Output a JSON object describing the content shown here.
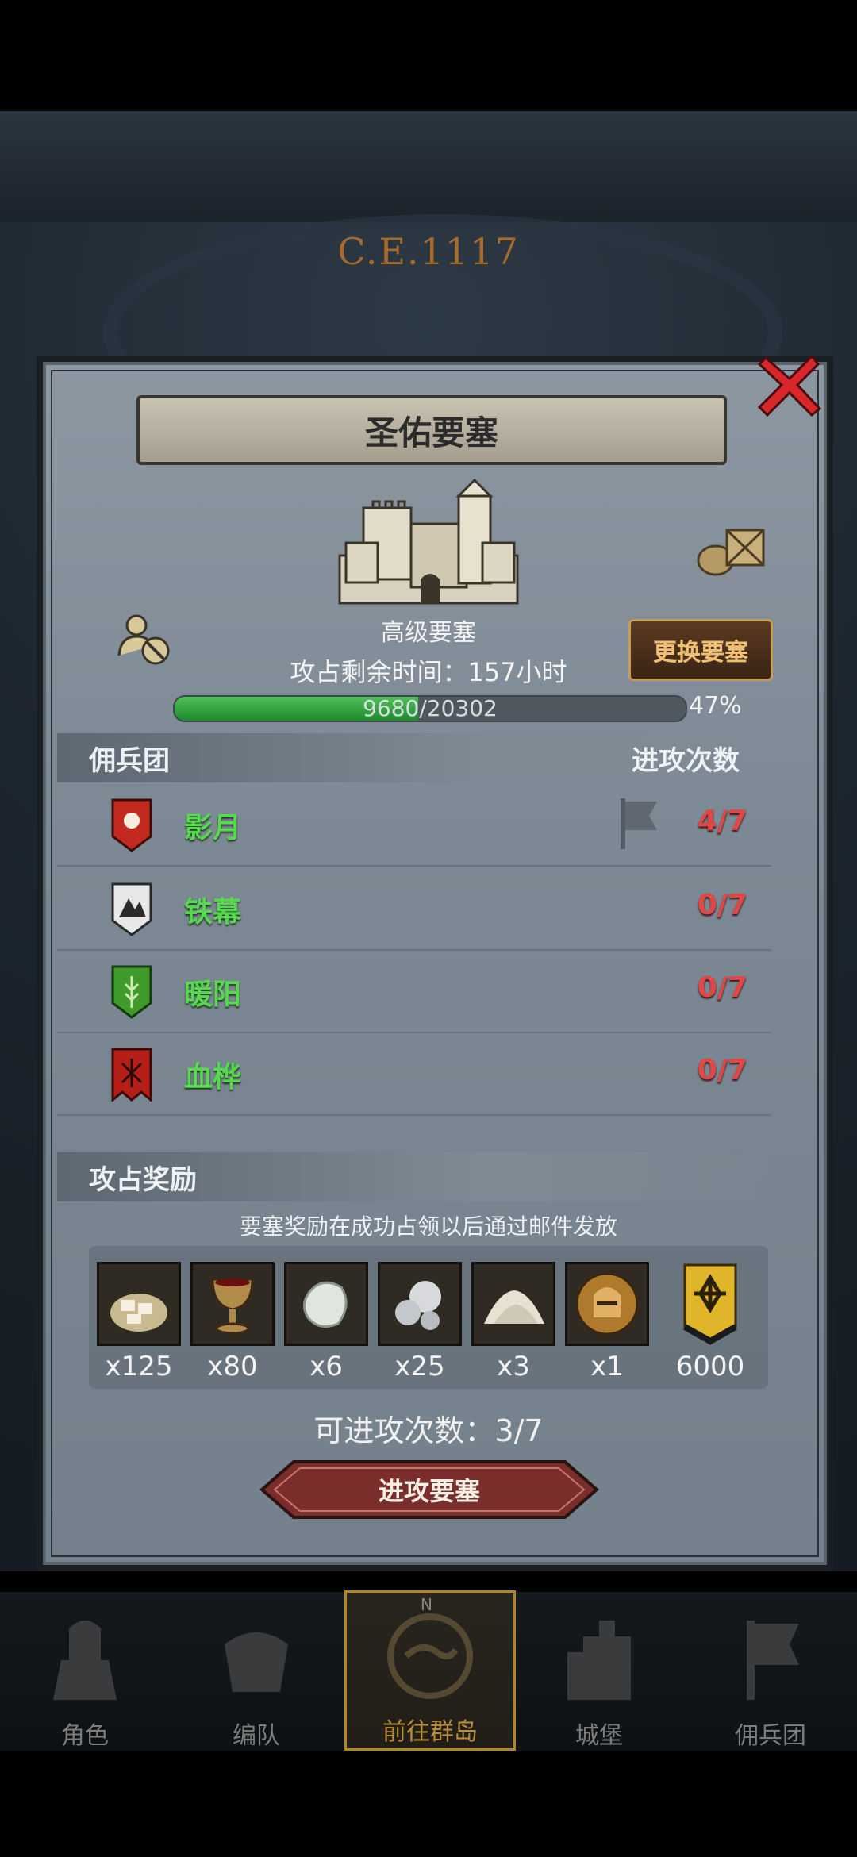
{
  "background": {
    "era_label": "C.E.1117"
  },
  "panel": {
    "title": "圣佑要塞",
    "fortress_type": "高级要塞",
    "time_left_label": "攻占剩余时间：157小时",
    "swap_button": "更换要塞",
    "progress": {
      "current": 9680,
      "total": 20302,
      "text": "9680/20302",
      "percent_label": "47%",
      "fraction": 0.477
    }
  },
  "mercenaries": {
    "header_left": "佣兵团",
    "header_right": "进攻次数",
    "rows": [
      {
        "name": "影月",
        "count": "4/7",
        "crest_color": "#c22a20",
        "has_flag": true
      },
      {
        "name": "铁幕",
        "count": "0/7",
        "crest_color": "#e8e8e8",
        "has_flag": false
      },
      {
        "name": "暖阳",
        "count": "0/7",
        "crest_color": "#3f9a2a",
        "has_flag": false
      },
      {
        "name": "血桦",
        "count": "0/7",
        "crest_color": "#b51f17",
        "has_flag": false
      }
    ]
  },
  "rewards": {
    "header": "攻占奖励",
    "note": "要塞奖励在成功占领以后通过邮件发放",
    "items": [
      {
        "icon": "bread-sack-icon",
        "qty": "x125"
      },
      {
        "icon": "goblet-icon",
        "qty": "x80"
      },
      {
        "icon": "pearl-stone-icon",
        "qty": "x6"
      },
      {
        "icon": "silver-orbs-icon",
        "qty": "x25"
      },
      {
        "icon": "salt-pile-icon",
        "qty": "x3"
      },
      {
        "icon": "knight-helmet-icon",
        "qty": "x1"
      },
      {
        "icon": "gold-emblem-icon",
        "qty": "6000"
      }
    ]
  },
  "attacks_available": "可进攻次数：3/7",
  "attack_button": "进攻要塞",
  "nav": {
    "compass_n": "N",
    "items": [
      {
        "label": "角色",
        "active": false
      },
      {
        "label": "编队",
        "active": false
      },
      {
        "label": "前往群岛",
        "active": true
      },
      {
        "label": "城堡",
        "active": false
      },
      {
        "label": "佣兵团",
        "active": false
      }
    ]
  }
}
